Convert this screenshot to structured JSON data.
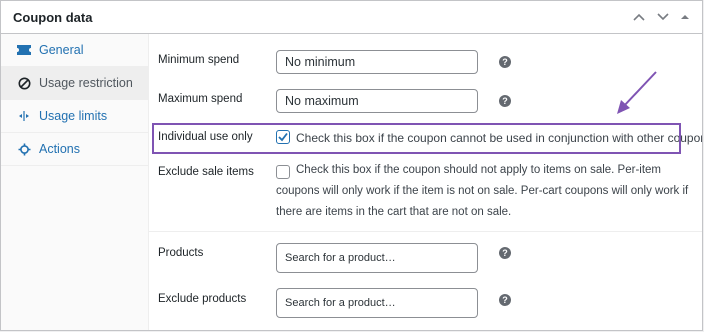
{
  "panel": {
    "title": "Coupon data"
  },
  "sidebar": {
    "items": [
      {
        "label": "General",
        "icon": "ticket-icon"
      },
      {
        "label": "Usage restriction",
        "icon": "block-icon"
      },
      {
        "label": "Usage limits",
        "icon": "arrows-icon"
      },
      {
        "label": "Actions",
        "icon": "gear-icon"
      }
    ],
    "active_index": 1
  },
  "fields": {
    "min_spend": {
      "label": "Minimum spend",
      "placeholder": "No minimum"
    },
    "max_spend": {
      "label": "Maximum spend",
      "placeholder": "No maximum"
    },
    "individual_use": {
      "label": "Individual use only",
      "checked": true,
      "description": "Check this box if the coupon cannot be used in conjunction with other coupons."
    },
    "exclude_sale": {
      "label": "Exclude sale items",
      "checked": false,
      "line1": "Check this box if the coupon should not apply to items on sale. Per-item",
      "line2": "coupons will only work if the item is not on sale. Per-cart coupons will only work if",
      "line3": "there are items in the cart that are not on sale."
    },
    "products": {
      "label": "Products",
      "placeholder": "Search for a product…"
    },
    "exclude_products": {
      "label": "Exclude products",
      "placeholder": "Search for a product…"
    }
  },
  "help_glyph": "?",
  "colors": {
    "link": "#2271b1",
    "highlight": "#7f54b3",
    "checkbox_checked": "#2271b1"
  }
}
